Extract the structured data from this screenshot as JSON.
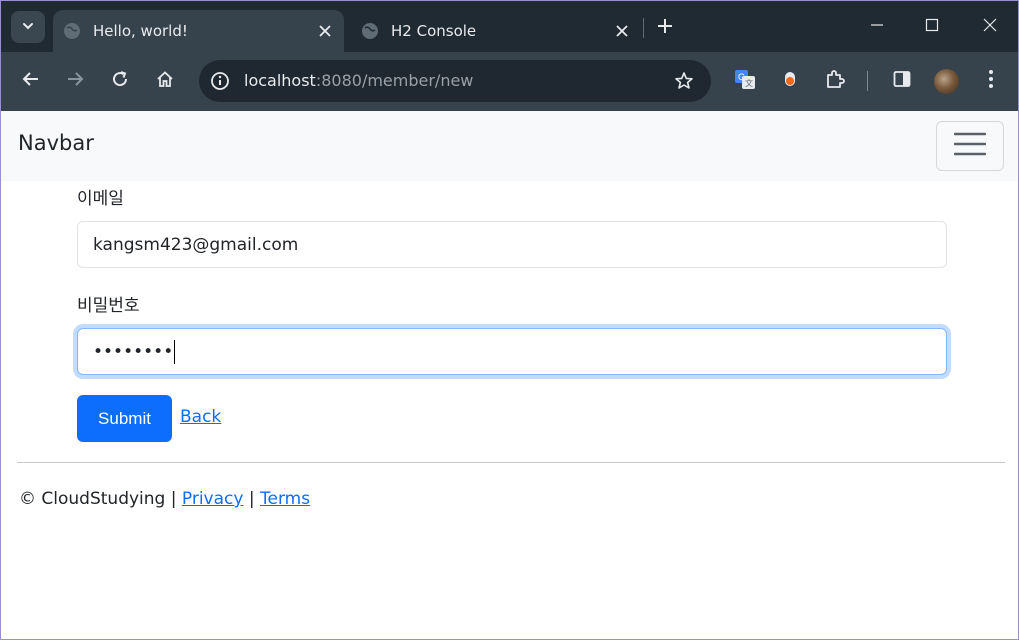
{
  "browser": {
    "tabs": [
      {
        "title": "Hello, world!",
        "active": true
      },
      {
        "title": "H2 Console",
        "active": false
      }
    ],
    "url_host": "localhost",
    "url_rest": ":8080/member/new"
  },
  "navbar": {
    "brand": "Navbar"
  },
  "form": {
    "email_label": "이메일",
    "email_value": "kangsm423@gmail.com",
    "password_label": "비밀번호",
    "password_masked": "••••••••",
    "submit_label": "Submit",
    "back_label": "Back"
  },
  "footer": {
    "copyright": "© CloudStudying",
    "sep1": "|",
    "privacy": "Privacy",
    "sep2": "|",
    "terms": "Terms"
  },
  "colors": {
    "primary": "#0d6efd",
    "navbar_bg": "#f8f9fa",
    "chrome_bg": "#202a33",
    "toolbar_bg": "#36434d"
  }
}
